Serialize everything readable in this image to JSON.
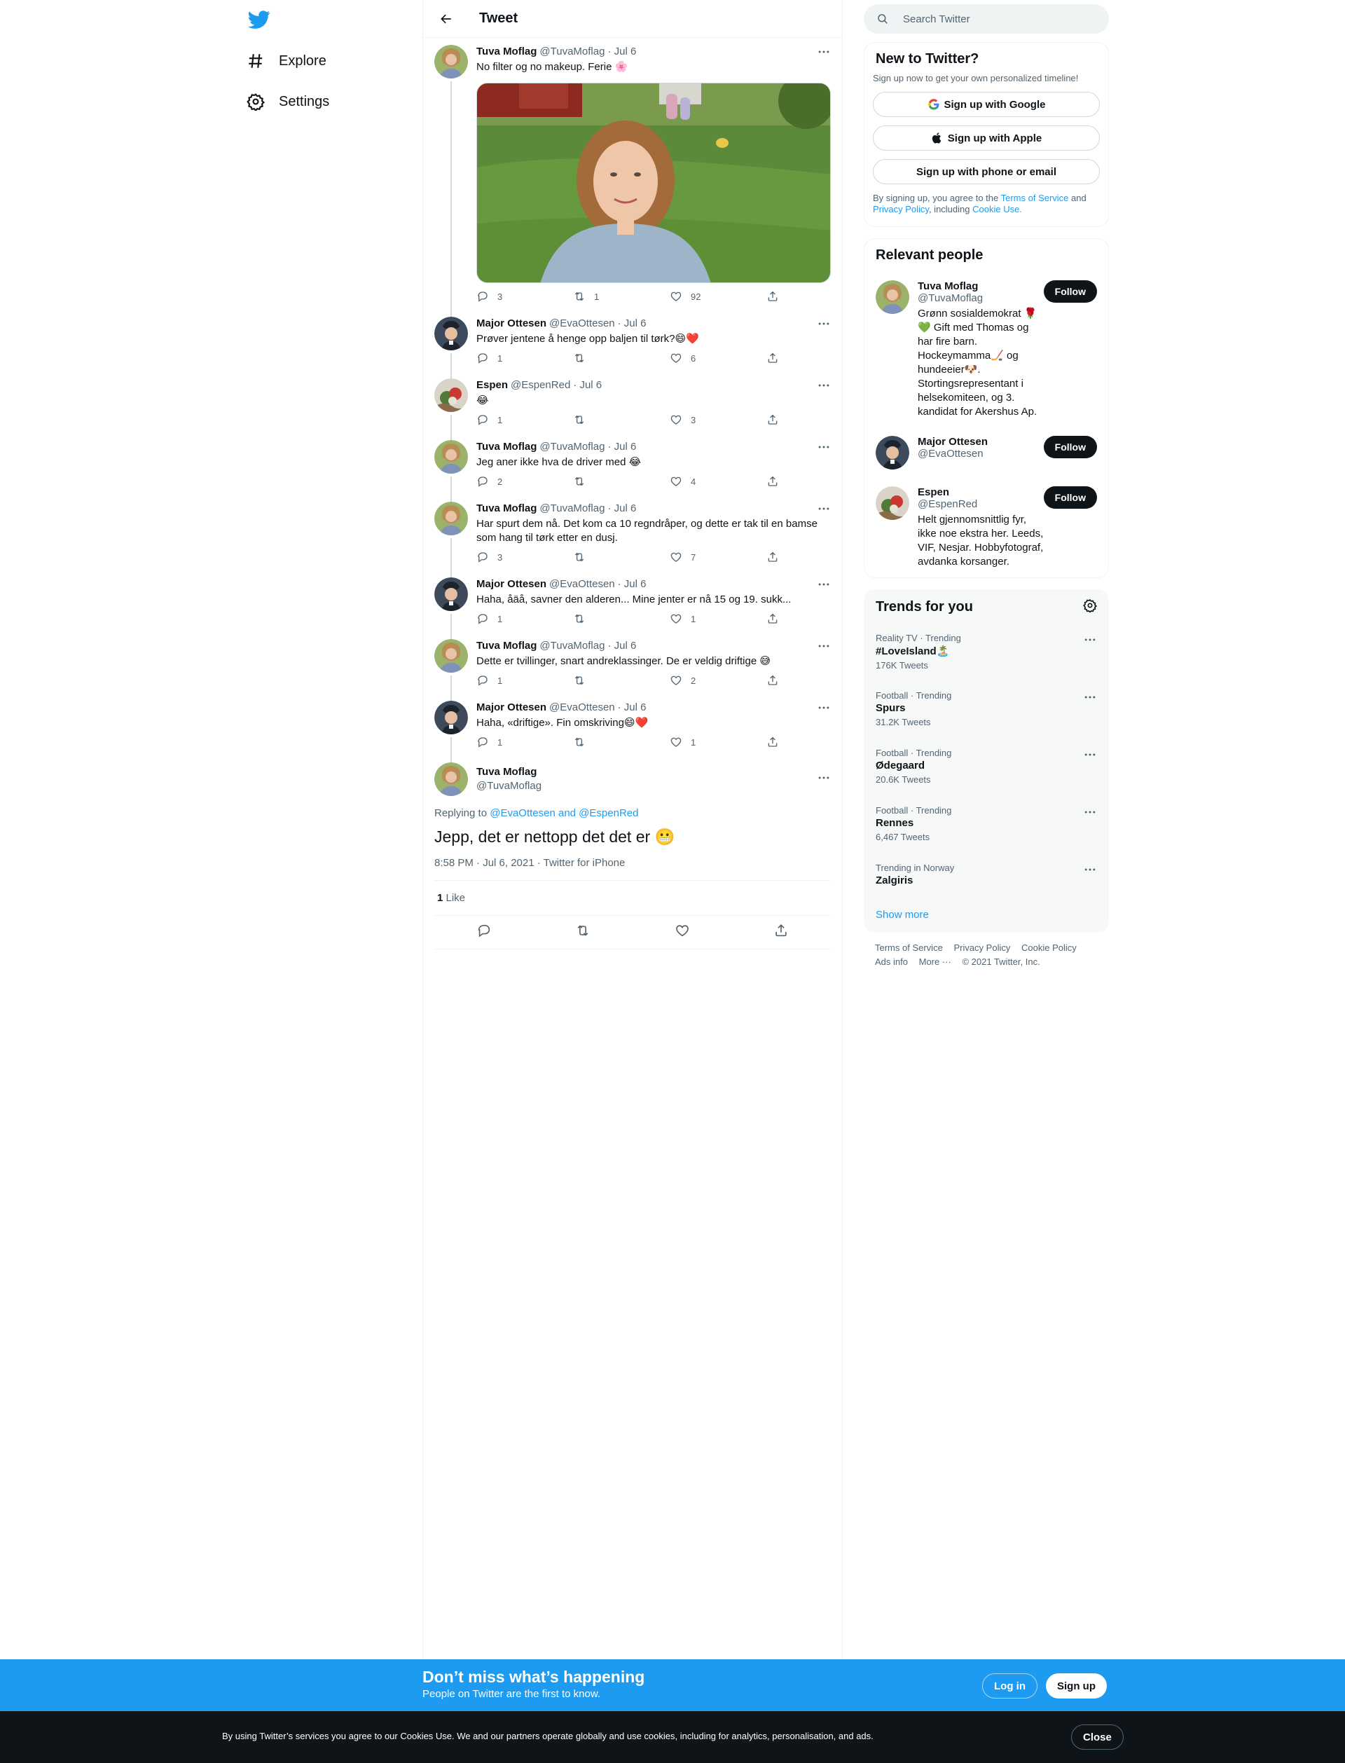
{
  "colors": {
    "brand": "#1d9bf0",
    "text": "#0f1419",
    "muted": "#536471",
    "border": "#eff3f4"
  },
  "nav": {
    "logo": "twitter-bird-icon",
    "items": [
      {
        "label": "Explore",
        "icon": "hashtag-icon"
      },
      {
        "label": "Settings",
        "icon": "gear-icon"
      }
    ]
  },
  "header": {
    "title": "Tweet"
  },
  "thread": [
    {
      "name": "Tuva Moflag",
      "handle": "@TuvaMoflag",
      "date": "· Jul 6",
      "text": "No filter og no makeup. Ferie 🌸",
      "has_media": true,
      "replies": "3",
      "retweets": "1",
      "likes": "92"
    },
    {
      "name": "Major Ottesen",
      "handle": "@EvaOttesen",
      "date": "· Jul 6",
      "text": "Prøver jentene å henge opp baljen til tørk?😄❤️",
      "replies": "1",
      "retweets": "",
      "likes": "6"
    },
    {
      "name": "Espen",
      "handle": "@EspenRed",
      "date": "· Jul 6",
      "text": "😂",
      "replies": "1",
      "retweets": "",
      "likes": "3"
    },
    {
      "name": "Tuva Moflag",
      "handle": "@TuvaMoflag",
      "date": "· Jul 6",
      "text": "Jeg aner ikke hva de driver med 😂",
      "replies": "2",
      "retweets": "",
      "likes": "4"
    },
    {
      "name": "Tuva Moflag",
      "handle": "@TuvaMoflag",
      "date": "· Jul 6",
      "text": "Har spurt dem nå. Det kom ca 10 regndråper, og dette er tak til en bamse som hang til tørk etter en dusj.",
      "replies": "3",
      "retweets": "",
      "likes": "7"
    },
    {
      "name": "Major Ottesen",
      "handle": "@EvaOttesen",
      "date": "· Jul 6",
      "text": "Haha, åäå, savner den alderen... Mine jenter er nå 15 og 19. sukk...",
      "replies": "1",
      "retweets": "",
      "likes": "1"
    },
    {
      "name": "Tuva Moflag",
      "handle": "@TuvaMoflag",
      "date": "· Jul 6",
      "text": "Dette er tvillinger, snart andreklassinger. De er veldig driftige 😅",
      "replies": "1",
      "retweets": "",
      "likes": "2"
    },
    {
      "name": "Major Ottesen",
      "handle": "@EvaOttesen",
      "date": "· Jul 6",
      "text": "Haha, «driftige». Fin omskriving😄❤️",
      "replies": "1",
      "retweets": "",
      "likes": "1"
    }
  ],
  "focus": {
    "name": "Tuva Moflag",
    "handle": "@TuvaMoflag",
    "replying_prefix": "Replying to ",
    "replying_to": "@EvaOttesen and @EspenRed",
    "text": "Jepp, det er nettopp det det er 😬",
    "meta": "8:58 PM · Jul 6, 2021 · Twitter for iPhone",
    "like_count": "1",
    "like_label": " Like"
  },
  "search": {
    "placeholder": "Search Twitter"
  },
  "new_to_twitter": {
    "title": "New to Twitter?",
    "subtitle": "Sign up now to get your own personalized timeline!",
    "google": "Sign up with Google",
    "apple": "Sign up with Apple",
    "phone": "Sign up with phone or email",
    "legal_1": "By signing up, you agree to the ",
    "tos": "Terms of Service",
    "legal_2": " and ",
    "privacy": "Privacy Policy",
    "legal_3": ", including ",
    "cookie": "Cookie Use."
  },
  "relevant": {
    "title": "Relevant people",
    "follow": "Follow",
    "people": [
      {
        "name": "Tuva Moflag",
        "handle": "@TuvaMoflag",
        "bio": "Grønn sosialdemokrat 🌹💚 Gift med Thomas og har fire barn. Hockeymamma🏒 og hundeeier🐶. Stortingsrepresentant i helsekomiteen, og 3. kandidat for Akershus Ap."
      },
      {
        "name": "Major Ottesen",
        "handle": "@EvaOttesen",
        "bio": ""
      },
      {
        "name": "Espen",
        "handle": "@EspenRed",
        "bio": "Helt gjennomsnittlig fyr, ikke noe ekstra her. Leeds, VIF, Nesjar. Hobbyfotograf, avdanka korsanger."
      }
    ]
  },
  "trends": {
    "title": "Trends for you",
    "items": [
      {
        "context": "Reality TV · Trending",
        "name": "#LoveIsland🏝️",
        "count": "176K Tweets"
      },
      {
        "context": "Football · Trending",
        "name": "Spurs",
        "count": "31.2K Tweets"
      },
      {
        "context": "Football · Trending",
        "name": "Ødegaard",
        "count": "20.6K Tweets"
      },
      {
        "context": "Football · Trending",
        "name": "Rennes",
        "count": "6,467 Tweets"
      },
      {
        "context": "Trending in Norway",
        "name": "Zalgiris",
        "count": ""
      }
    ],
    "show_more": "Show more"
  },
  "footer": {
    "terms": "Terms of Service",
    "privacy": "Privacy Policy",
    "cookie": "Cookie Policy",
    "ads": "Ads info",
    "more": "More ···",
    "copyright": "© 2021 Twitter, Inc."
  },
  "bottom_bar": {
    "headline": "Don’t miss what’s happening",
    "sub": "People on Twitter are the first to know.",
    "login": "Log in",
    "signup": "Sign up"
  },
  "cookie_bar": {
    "text": "By using Twitter’s services you agree to our Cookies Use. We and our partners operate globally and use cookies, including for analytics, personalisation, and ads.",
    "close": "Close"
  }
}
